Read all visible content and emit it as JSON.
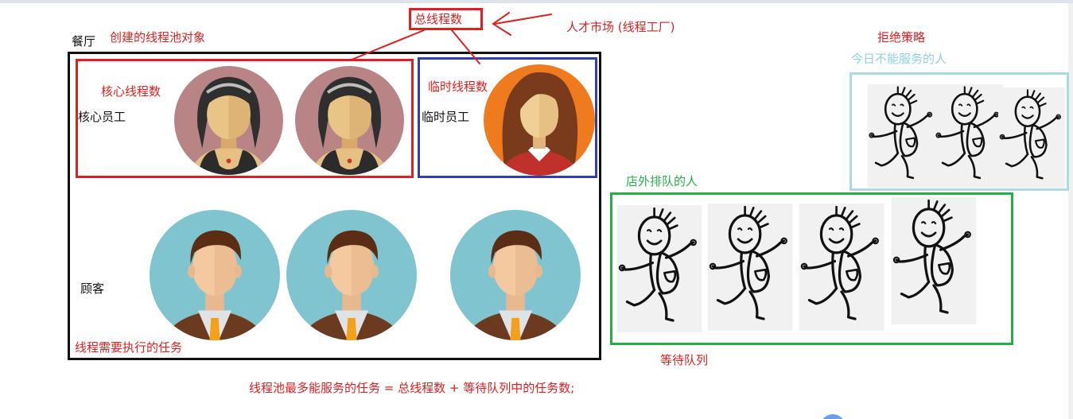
{
  "labels": {
    "total_threads": "总线程数",
    "talent_market": "人才市场 (线程工厂)",
    "restaurant": "餐厅",
    "pool_object": "创建的线程池对象",
    "core_threads": "核心线程数",
    "core_staff": "核心员工",
    "temp_threads": "临时线程数",
    "temp_staff": "临时员工",
    "customers": "顾客",
    "tasks": "线程需要执行的任务",
    "reject_policy": "拒绝策略",
    "reject_desc": "今日不能服务的人",
    "queue_people": "店外排队的人",
    "wait_queue": "等待队列",
    "formula": "线程池最多能服务的任务 = 总线程数 + 等待队列中的任务数;"
  },
  "colors": {
    "red": "#e02020",
    "blue": "#2f3faf",
    "green": "#27ae47",
    "light_blue": "#a8dbe6",
    "black": "#111111",
    "core_avatar_bg": "#b98486",
    "temp_avatar_bg": "#f07a1e",
    "customer_avatar_bg": "#80c4cf"
  },
  "icons": {
    "core_staff": "female-staff-avatar-icon",
    "temp_staff": "female-temp-staff-avatar-icon",
    "customer": "male-customer-avatar-icon",
    "person": "stick-figure-backpack-icon"
  }
}
